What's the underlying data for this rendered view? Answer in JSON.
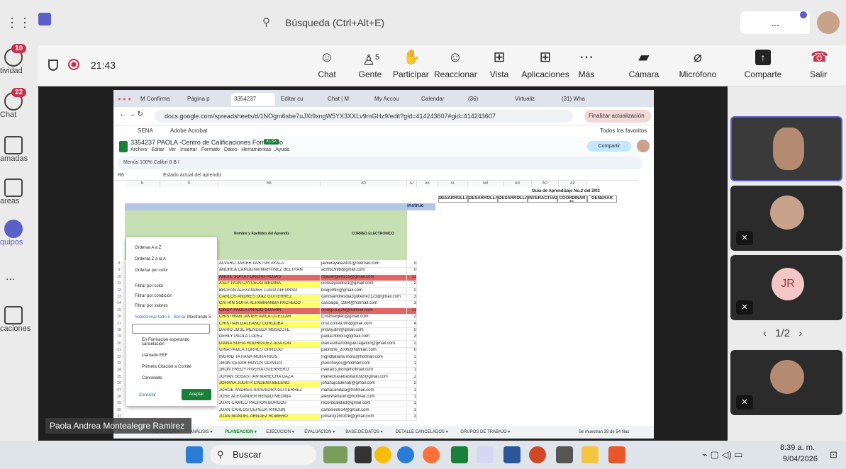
{
  "teams": {
    "search_placeholder": "Búsqueda (Ctrl+Alt+E)",
    "more": "...",
    "rail": [
      {
        "label": "tividad",
        "badge": "10"
      },
      {
        "label": "Chat",
        "badge": "22"
      },
      {
        "label": "amadas"
      },
      {
        "label": "areas"
      },
      {
        "label": "quipos"
      },
      {
        "label": "..."
      },
      {
        "label": "caciones"
      }
    ],
    "meeting": {
      "timer": "21:43",
      "controls": {
        "chat": "Chat",
        "people": "Gente",
        "people_count": "5",
        "raise": "Participar",
        "react": "Reaccionar",
        "view": "Vista",
        "apps": "Aplicaciones",
        "more": "Más",
        "camera": "Cámara",
        "mic": "Micrófono",
        "share": "Comparte",
        "leave": "Salir"
      }
    },
    "presenter_name": "Paola Andrea Montealegre Ramirez",
    "participants": {
      "initials": "JR",
      "page": "1/2"
    }
  },
  "browser": {
    "tabs": [
      "M Confirma",
      "Página p",
      "3354237",
      "Editar cu",
      "Chat | M",
      "My Accou",
      "Calendar",
      "(36)",
      "Virtualiz",
      "(31) Wha"
    ],
    "url": "docs.google.com/spreadsheets/d/1NOgm6sbe7uJXt9xngW5YX3XXLv9mGHz9/edit?gid=414243607#gid=414243607",
    "update_btn": "Finalizar actualización",
    "bookmarks": [
      "SENA",
      "Adobe Acrobat"
    ],
    "all_bookmarks": "Todos los favoritos"
  },
  "sheet": {
    "title": "3354237 PAOLA -Centro de Calificaciones Formulado",
    "badge": "XLSX",
    "menu": [
      "Archivo",
      "Editar",
      "Ver",
      "Insertar",
      "Formato",
      "Datos",
      "Herramientas",
      "Ayuda"
    ],
    "share": "Compartir",
    "toolbar": "Menús   100%   Calibri   8   B I",
    "cell_ref": "R6",
    "formula": "Estado actual del aprendiz",
    "col_headers": [
      "N",
      "R",
      "AB",
      "AD",
      "AJ",
      "AK",
      "AL",
      "AM",
      "AN",
      "AO",
      "AP"
    ],
    "guide_title": "Guía de Aprendizaje No.2 del 2/02",
    "instruc": "instruc",
    "phase_headers": [
      "DESARROLLAR",
      "DESARROLLAR",
      "DESARROLLAR",
      "INTERACTUAR",
      "COORDINAR EL",
      "GENERAR"
    ],
    "col_names": [
      "Nombre y Apellidos del Aprendiz",
      "CORREO ELECTRONICO"
    ],
    "rows": [
      {
        "name": "ALVARO JAVIER PASTOR AYALA",
        "email": "javiierayala2401@hotmail.com",
        "n": "0",
        "color": "#ffffff"
      },
      {
        "name": "ANDREA CAROLINA MARTINEZ BELTRAN",
        "email": "acmb1998@gmail.com",
        "n": "0",
        "color": "#ffffff"
      },
      {
        "name": "ANGIE SOFIA FORERO ROJAS",
        "email": "rojasangie0315@gmail.com",
        "n": "11",
        "color": "#e06666"
      },
      {
        "name": "ASLY IVON CAYCEDO MEDINA",
        "email": "ivoncaycedo21@gmail.com",
        "n": "2",
        "color": "#ffff66"
      },
      {
        "name": "BRAYAN ALEXANDER LUGO ALFONSO",
        "email": "blugo995@gmail.com",
        "n": "0",
        "color": "#ffffff"
      },
      {
        "name": "CARLOS ANDRES DIAZ GUTIERREZ",
        "email": "carlosandresdiazgutierrez123@gmail.com",
        "n": "3",
        "color": "#ffff66"
      },
      {
        "name": "CATRIN SOFIA ALTAMIRANDA PACHECO",
        "email": "casoalpa_1984@hotmail.com",
        "n": "3",
        "color": "#ffff66"
      },
      {
        "name": "CINDY PAOLA PRADO GUARIN",
        "email": "cindyp.p.g26@hotmail.com",
        "n": "11",
        "color": "#e06666"
      },
      {
        "name": "CRISTHIAN JAVIER AVILA CUELLAR",
        "email": "Cristhianjf4c@gmail.com",
        "n": "2",
        "color": "#ffff66"
      },
      {
        "name": "CRISTIAN GALEANO CORDOBA",
        "email": "crist.correa.90@gmail.com",
        "n": "4",
        "color": "#ffff66"
      },
      {
        "name": "DARIO JOSE MENDOZA MOSCOTE",
        "email": "jlriowy.dm@gmail.com",
        "n": "0",
        "color": "#ffffff"
      },
      {
        "name": "DERLY PAOLA LOPEZ",
        "email": "paola198533@gmail.com",
        "n": "3",
        "color": "#ffffff"
      },
      {
        "name": "DIANA SOFIA RODRIGUEZ AGATON",
        "email": "dianasofiarodriguezagaton@gmail.com",
        "n": "2",
        "color": "#ffff66"
      },
      {
        "name": "GINA PAOLA TORRES URREGO",
        "email": "paonline_2006@hotmail.com",
        "n": "0",
        "color": "#ffffff"
      },
      {
        "name": "INGRID TATIANA MORA RIOS",
        "email": "Ingridtatiana.mora@hotmail.com",
        "n": "1",
        "color": "#ffffff"
      },
      {
        "name": "JHON CESAR HOYOS CLAVIJO",
        "email": "jhonchoyos@hotmail.com",
        "n": "1",
        "color": "#ffffff"
      },
      {
        "name": "JHON FREDY RIVERA GUERRERO",
        "email": "rivera03.jhon@hotmail.com",
        "n": "1",
        "color": "#ffffff"
      },
      {
        "name": "JOHAN SEBASTIAN MAHECHA DAZA",
        "email": "mahechasebastian092@gmail.com",
        "n": "1",
        "color": "#ffffff"
      },
      {
        "name": "JOHANA JUDITH CADENA BELEÑO",
        "email": "johanajcadenab@gmail.com",
        "n": "2",
        "color": "#ffff66"
      },
      {
        "name": "JORGE ANDRES SAAVEDRA GUTIERREZ",
        "email": "mahacandala@hotmail.com",
        "n": "1",
        "color": "#ffffff"
      },
      {
        "name": "JOSE ALEXANDER HENAO MEDINA",
        "email": "alexishenaom@hotmail.com",
        "n": "1",
        "color": "#ffffff"
      },
      {
        "name": "JUAN CAMILO PACHON BURGOS",
        "email": "recordcalidad@gmail.com",
        "n": "1",
        "color": "#ffffff"
      },
      {
        "name": "JUAN CARLOS CEPEDA RINCON",
        "email": "carlosleo814@gmail.com",
        "n": "1",
        "color": "#ffffff"
      },
      {
        "name": "JUAN MANUEL ARGAEZ ROMERO",
        "email": "jumaroji160308@gmail.com",
        "n": "3",
        "color": "#ffff66"
      }
    ],
    "filter_menu": {
      "sort_az": "Ordenar A a Z",
      "sort_za": "Ordenar Z a la A",
      "sort_color": "Ordenar por color",
      "filter_color": "Filtrar por color",
      "filter_cond": "Filtrar por condición",
      "filter_values": "Filtrar por valores",
      "select_all": "Seleccionar todo 5 - Borrar",
      "showing": "Mostrando 5",
      "options": [
        "En Formacion esperando cancelación",
        "Llamado EEF",
        "Primera Citación a Comité",
        "Cancelado"
      ],
      "cancel": "Cancelar",
      "accept": "Aceptar"
    },
    "sheet_tabs": [
      "INDUCCION",
      "ANÁLISIS",
      "PLANEACION",
      "EJECUCION",
      "EVALUACION",
      "BASE DE DATOS",
      "DETALLE CANCELADOS",
      "GRUPOS DE TRABAJO"
    ],
    "rows_shown": "Se muestran 39 de 54 filas"
  },
  "taskbar": {
    "search": "Buscar",
    "time": "8:39 a. m.",
    "date": "9/04/2026"
  }
}
